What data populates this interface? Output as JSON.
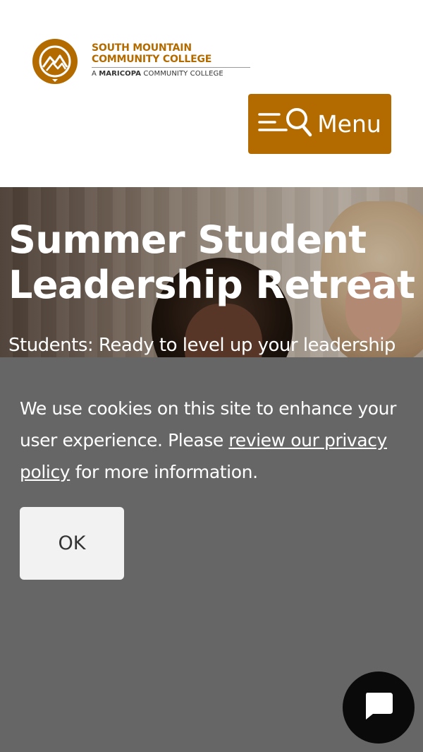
{
  "header": {
    "logo": {
      "line1": "SOUTH MOUNTAIN",
      "line2": "COMMUNITY COLLEGE",
      "sub_prefix": "A ",
      "sub_bold": "MARICOPA",
      "sub_suffix": " COMMUNITY COLLEGE"
    },
    "menu_label": "Menu"
  },
  "hero": {
    "title_line1": "Summer Student",
    "title_line2": "Leadership Retreat",
    "subtitle": "Students: Ready to level up your leadership"
  },
  "cookie_banner": {
    "text_before": "We use cookies on this site to enhance your user experience. Please ",
    "link_text": "review our privacy policy",
    "text_after": " for more information.",
    "ok_label": "OK"
  },
  "chat": {
    "icon": "chat-bubble-icon"
  },
  "colors": {
    "brand": "#b36b00",
    "banner_bg": "#666666",
    "ok_bg": "#f2f2f2",
    "chat_bg": "#0a0a0a"
  }
}
